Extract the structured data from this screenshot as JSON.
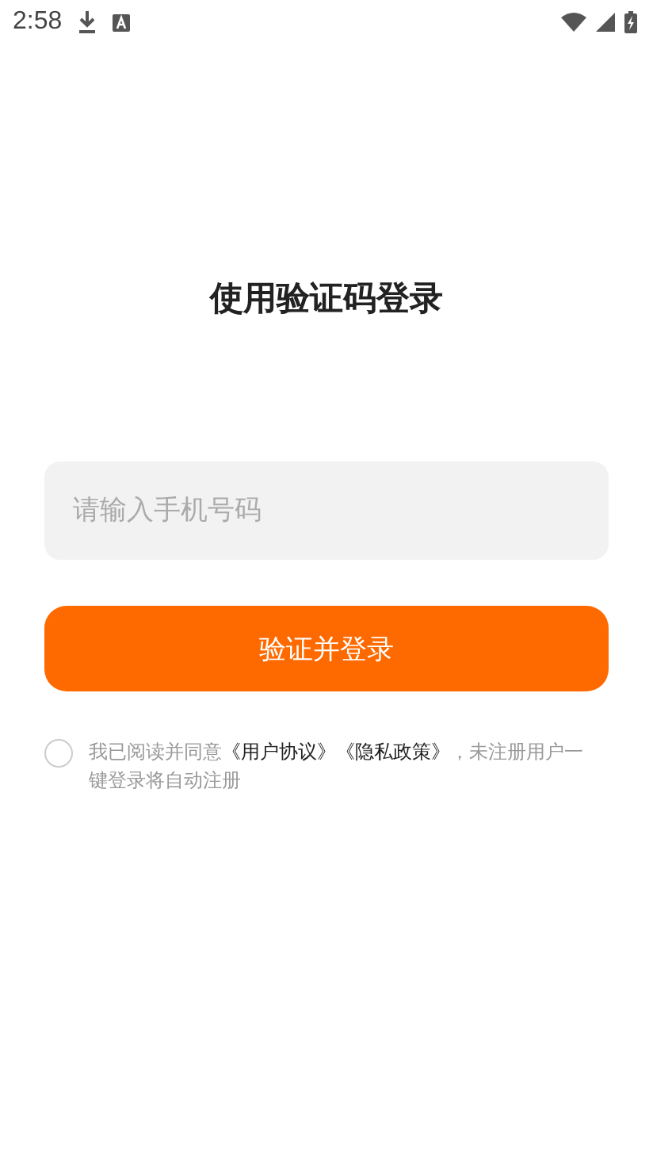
{
  "status_bar": {
    "time": "2:58"
  },
  "title": "使用验证码登录",
  "phone_field": {
    "placeholder": "请输入手机号码"
  },
  "submit_button": "验证并登录",
  "agreement": {
    "checked": false,
    "prefix": "我已阅读并同意",
    "links": [
      "《用户协议》",
      "《隐私政策》"
    ],
    "suffix": "，未注册用户一键登录将自动注册"
  }
}
